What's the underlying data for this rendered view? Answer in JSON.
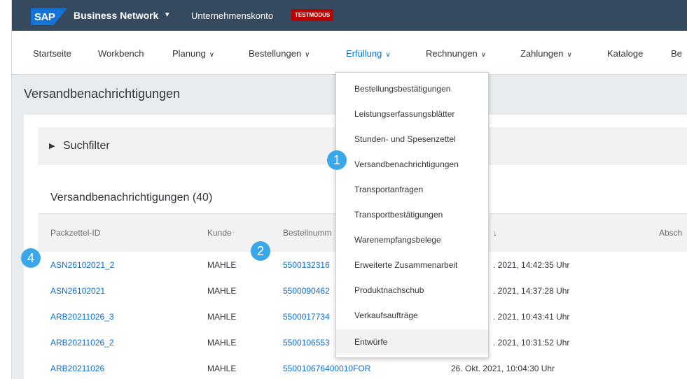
{
  "shell": {
    "logo": "SAP",
    "brand": "Business Network",
    "brand_caret": "▾",
    "account": "Unternehmenskonto",
    "test_badge": "TESTMODUS"
  },
  "nav": {
    "items": [
      {
        "label": "Startseite",
        "dropdown": false
      },
      {
        "label": "Workbench",
        "dropdown": false
      },
      {
        "label": "Planung",
        "dropdown": true
      },
      {
        "label": "Bestellungen",
        "dropdown": true
      },
      {
        "label": "Erfüllung",
        "dropdown": true,
        "active": true
      },
      {
        "label": "Rechnungen",
        "dropdown": true
      },
      {
        "label": "Zahlungen",
        "dropdown": true
      },
      {
        "label": "Kataloge",
        "dropdown": false
      },
      {
        "label": "Be",
        "dropdown": false
      }
    ],
    "chevron": "∨"
  },
  "page": {
    "title": "Versandbenachrichtigungen"
  },
  "filter": {
    "label": "Suchfilter",
    "arrow": "▶"
  },
  "table": {
    "title": "Versandbenachrichtigungen (40)",
    "headers": [
      "Packzettel-ID",
      "Kunde",
      "Bestellnumm",
      "↓",
      "Absch"
    ],
    "rows": [
      {
        "id": "ASN26102021_2",
        "customer": "MAHLE",
        "order": "5500132316",
        "date": ". 2021, 14:42:35 Uhr"
      },
      {
        "id": "ASN26102021",
        "customer": "MAHLE",
        "order": "5500090462",
        "date": ". 2021, 14:37:28 Uhr"
      },
      {
        "id": "ARB20211026_3",
        "customer": "MAHLE",
        "order": "5500017734",
        "date": ". 2021, 10:43:41 Uhr"
      },
      {
        "id": "ARB20211026_2",
        "customer": "MAHLE",
        "order": "5500106553",
        "date": ". 2021, 10:31:52 Uhr"
      },
      {
        "id": "ARB20211026",
        "customer": "MAHLE",
        "order": "550010676400010FOR",
        "date": "26. Okt. 2021, 10:04:30 Uhr"
      }
    ]
  },
  "dropdown": {
    "items": [
      "Bestellungsbestätigungen",
      "Leistungserfassungsblätter",
      "Stunden- und Spesenzettel",
      "Versandbenachrichtigungen",
      "Transportanfragen",
      "Transportbestätigungen",
      "Warenempfangsbelege",
      "Erweiterte Zusammenarbeit",
      "Produktnachschub",
      "Verkaufsaufträge",
      "Entwürfe"
    ]
  },
  "markers": [
    "1",
    "2",
    "4"
  ],
  "colors": {
    "shell": "#354a5f",
    "link": "#0a6ed1",
    "badge": "#bb0000",
    "marker": "#3aa7e8"
  }
}
